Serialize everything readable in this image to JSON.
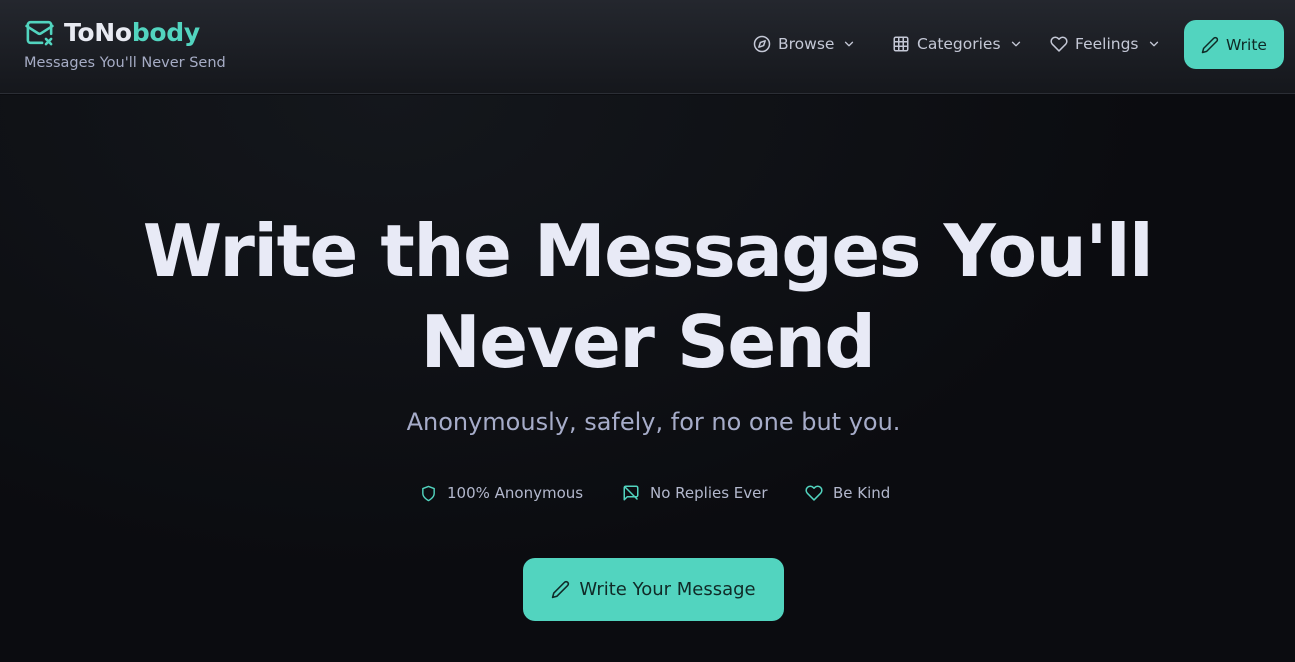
{
  "header": {
    "brand_part1": "ToNo",
    "brand_part2": "body",
    "tagline": "Messages You'll Never Send",
    "logo_icon": "mail-x-icon"
  },
  "nav": {
    "items": [
      {
        "label": "Browse",
        "icon": "compass-icon"
      },
      {
        "label": "Categories",
        "icon": "grid-icon"
      },
      {
        "label": "Feelings",
        "icon": "heart-icon"
      }
    ],
    "write_label": "Write"
  },
  "hero": {
    "title_line1": "Write the Messages You'll",
    "title_line2": "Never Send",
    "subtitle": "Anonymously, safely, for no one but you.",
    "features": [
      {
        "label": "100% Anonymous",
        "icon": "shield-icon"
      },
      {
        "label": "No Replies Ever",
        "icon": "message-off-icon"
      },
      {
        "label": "Be Kind",
        "icon": "heart-icon"
      }
    ],
    "cta_label": "Write Your Message"
  },
  "colors": {
    "accent": "#52d4bf",
    "background": "#0b0c10",
    "header_bg": "#1c1f25",
    "title_text": "#e8eaf6",
    "muted_text": "#a6acc9"
  }
}
